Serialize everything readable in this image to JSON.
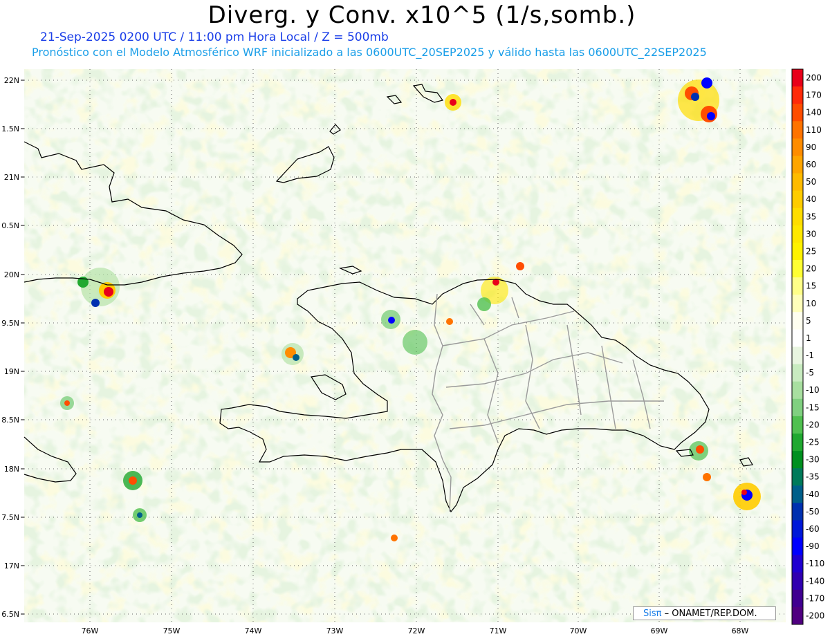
{
  "header": {
    "title": "Diverg. y Conv. x10^5 (1/s,somb.)",
    "subtitle_date": "21-Sep-2025 0200 UTC / 11:00 pm Hora Local / Z = 500mb",
    "subtitle_model": "Pronóstico con el Modelo Atmosférico WRF inicializado a las 0600UTC_20SEP2025 y válido hasta las  0600UTC_22SEP2025"
  },
  "map": {
    "lat_labels": [
      "22N",
      "1.5N",
      "21N",
      "0.5N",
      "20N",
      "9.5N",
      "19N",
      "8.5N",
      "18N",
      "7.5N",
      "17N",
      "6.5N"
    ],
    "lon_labels": [
      "76W",
      "75W",
      "74W",
      "73W",
      "72W",
      "71W",
      "70W",
      "69W",
      "68W"
    ]
  },
  "colorbar": {
    "labels": [
      "200",
      "170",
      "140",
      "110",
      "90",
      "60",
      "50",
      "40",
      "35",
      "30",
      "25",
      "20",
      "15",
      "10",
      "5",
      "1",
      "-1",
      "-5",
      "-10",
      "-15",
      "-20",
      "-25",
      "-30",
      "-35",
      "-40",
      "-50",
      "-60",
      "-90",
      "-110",
      "-140",
      "-170",
      "-200"
    ],
    "colors": [
      "#e8001a",
      "#ff2a0a",
      "#ff4d00",
      "#ff7300",
      "#ff8c00",
      "#ffa500",
      "#ffbb00",
      "#ffcc00",
      "#ffdd00",
      "#ffe800",
      "#fff200",
      "#ffff33",
      "#ffff88",
      "#ffffbb",
      "#fffff0",
      "#ffffff",
      "#e8f5e0",
      "#c8ebc0",
      "#a8dfa0",
      "#80d080",
      "#50c050",
      "#20a830",
      "#009020",
      "#007a5a",
      "#005f8a",
      "#0030b0",
      "#0018d8",
      "#0000ff",
      "#2000d0",
      "#3000b0",
      "#400090",
      "#500080"
    ]
  },
  "credit": {
    "logo": "Sisπ",
    "text": "– ONAMET/REP.DOM."
  }
}
